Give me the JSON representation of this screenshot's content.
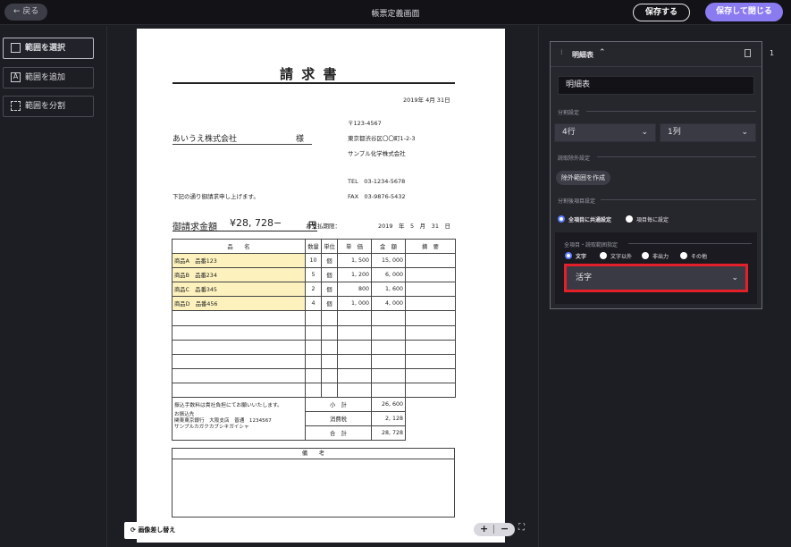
{
  "header": {
    "back_label": "← 戻る",
    "title": "帳票定義画面",
    "save_label": "保存する",
    "save_close_label": "保存して閉じる"
  },
  "tools": [
    {
      "label": "範囲を選択"
    },
    {
      "label": "範囲を追加"
    },
    {
      "label": "範囲を分割"
    }
  ],
  "document": {
    "title": "請 求 書",
    "date": "2019年 4月 31日",
    "customer": "あいうえ株式会社",
    "honorific": "様",
    "postal": "〒123-4567",
    "address": "東京都渋谷区〇〇町1-2-3",
    "company": "サンプル化学株式会社",
    "tel": "TEL　03-1234-5678",
    "fax": "FAX　03-9876-5432",
    "intro": "下記の通り御請求申し上げます。",
    "amount_label": "御請求金額",
    "amount_value": "¥28, 728−",
    "amount_unit": "円",
    "due_label": "お支払期限：",
    "due_date": "2019　年　5　月　31　日",
    "table_headers": [
      "品　　名",
      "数量",
      "単位",
      "単　価",
      "金　額",
      "摘　要"
    ],
    "rows": [
      {
        "name": "商品A　品番123",
        "qty": "10",
        "unit": "個",
        "price": "1, 500",
        "amount": "15, 000"
      },
      {
        "name": "商品B　品番234",
        "qty": "5",
        "unit": "個",
        "price": "1, 200",
        "amount": "6, 000"
      },
      {
        "name": "商品C　品番345",
        "qty": "2",
        "unit": "個",
        "price": "800",
        "amount": "1, 600"
      },
      {
        "name": "商品D　品番456",
        "qty": "4",
        "unit": "個",
        "price": "1, 000",
        "amount": "4, 000"
      }
    ],
    "fee_note": "振込手数料は貴社負担にてお願いいたします。",
    "bank_label": "お振込先",
    "bank_line1": "関東東京銀行　大阪支店　普通　1234567",
    "bank_line2": "サンプルカガクカブシキガイシャ",
    "subtotal_label": "小　計",
    "subtotal_value": "26, 600",
    "tax_label": "消費税",
    "tax_value": "2, 128",
    "total_label": "合　計",
    "total_value": "28, 728",
    "remarks_label": "備　　考"
  },
  "canvas": {
    "replace_image_label": "画像差し替え",
    "zoom_in": "+",
    "zoom_out": "−",
    "fit_icon": "⛶"
  },
  "panel": {
    "page_number": "1",
    "card_title": "明細表",
    "name_value": "明細表",
    "split_label": "分割設定",
    "rows_value": "4行",
    "cols_value": "1列",
    "exclude_label": "読取除外設定",
    "exclude_button": "除外範囲を作成",
    "item_label": "分割後項目設定",
    "radio_common": "全項目に共通設定",
    "radio_each": "項目毎に設定",
    "read_spec_label": "全項目・読取範囲指定",
    "opt_text": "文字",
    "opt_nontext": "文字以外",
    "opt_noout": "非出力",
    "opt_other": "その他",
    "font_value": "活字"
  },
  "colors": {
    "accent": "#8b7bf0",
    "highlight": "#e3202a",
    "row_highlight": "#fdf2be"
  }
}
